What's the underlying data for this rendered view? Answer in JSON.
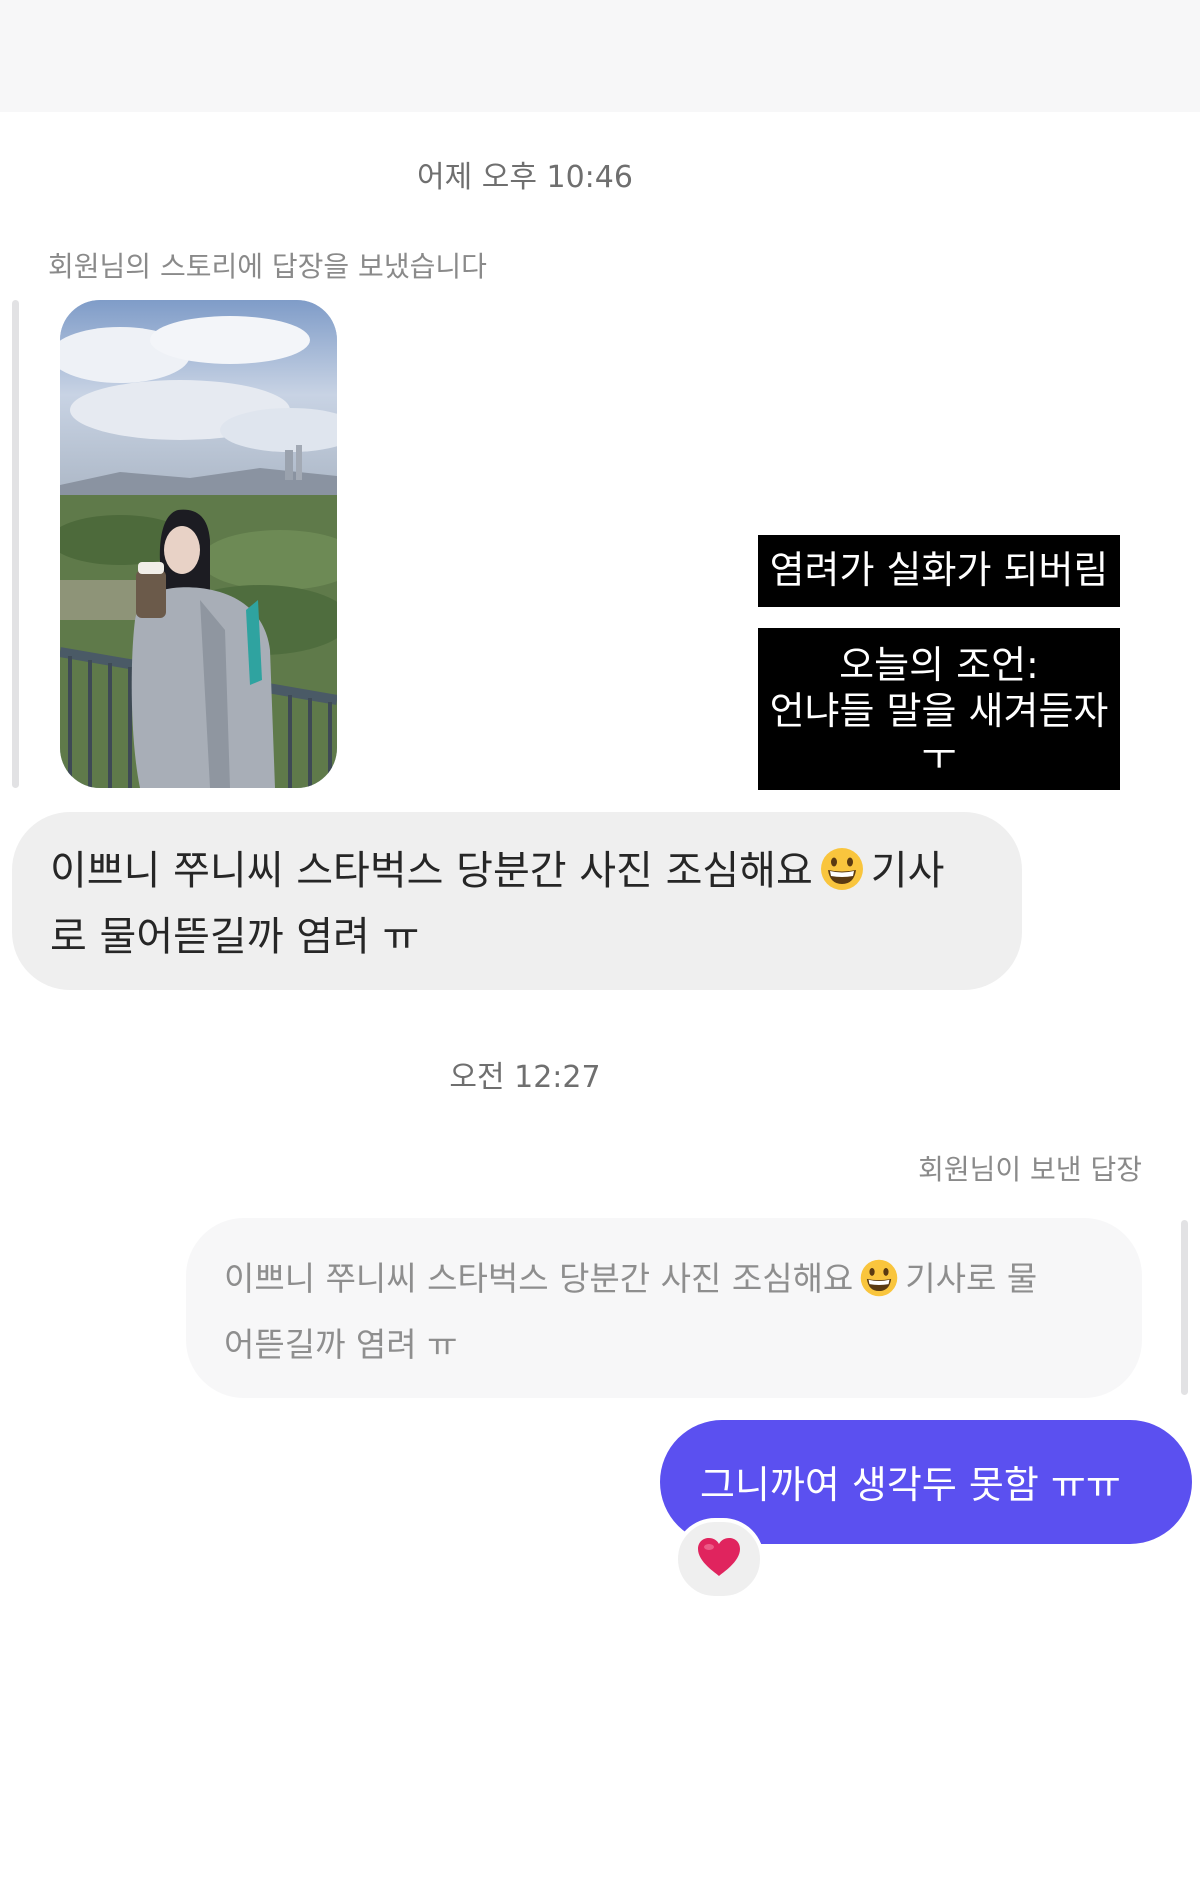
{
  "timestamps": {
    "first": "어제 오후 10:46",
    "second": "오전 12:27"
  },
  "story_reply_label": "회원님의 스토리에 답장을 보냈습니다",
  "story_captions": {
    "caption1": "염려가 실화가 되버림",
    "caption2_line1": "오늘의 조언:",
    "caption2_line2": "언냐들 말을 새겨듣자",
    "caption2_line3": "ㅜ"
  },
  "incoming_message": {
    "line1_before": "이쁘니 쭈니씨 스타벅스 당분간 사진 조심해요",
    "line1_after": "기사",
    "line2": "로 물어뜯길까 염려 ㅠ",
    "emoji": "grinning-face-emoji"
  },
  "quoted_reply_label": "회원님이 보낸 답장",
  "quoted_message": {
    "line1_before": "이쁘니 쭈니씨 스타벅스 당분간 사진 조심해요",
    "line1_after": "기사로 물",
    "line2": "어뜯길까 염려 ㅠ",
    "emoji": "grinning-face-emoji"
  },
  "outgoing_message": {
    "text": "그니까여 생각두 못함 ㅠㅠ"
  },
  "reaction": {
    "icon": "red-heart-icon",
    "color": "#e0245e"
  },
  "colors": {
    "outgoing_bubble": "#5b50f0",
    "incoming_bubble": "#efefef",
    "quoted_bubble": "#f7f7f8"
  }
}
